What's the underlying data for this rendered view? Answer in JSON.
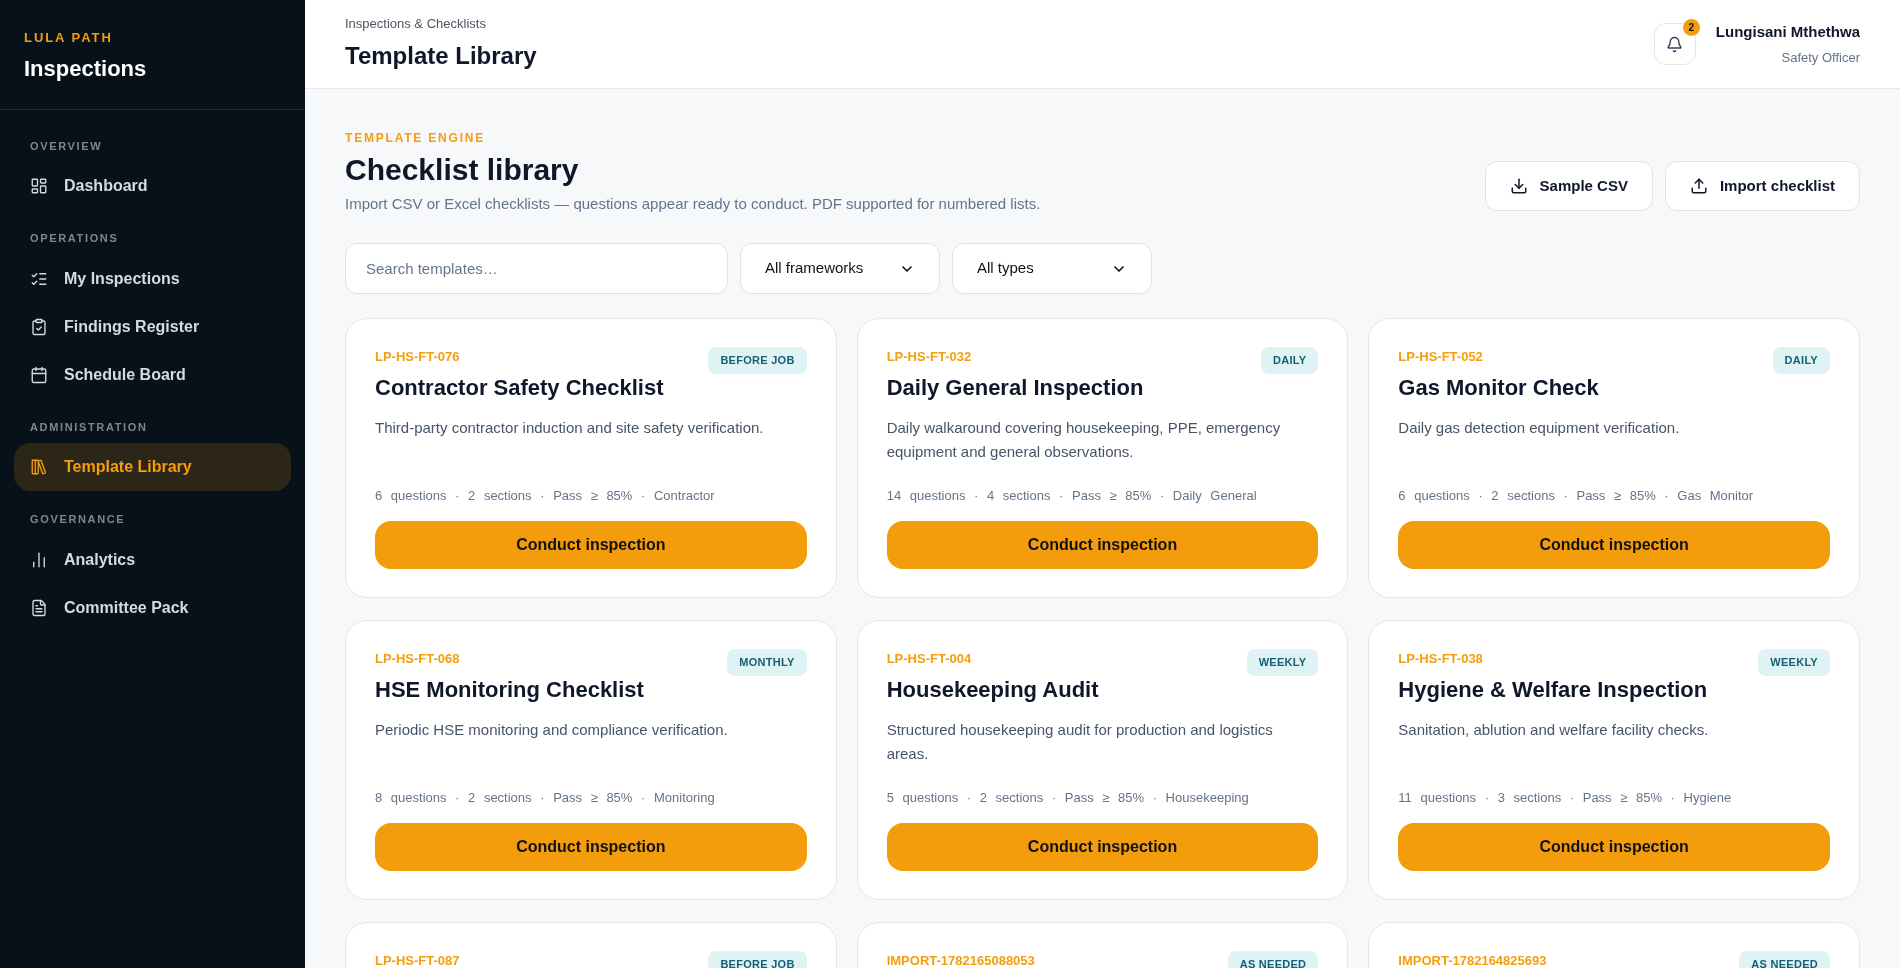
{
  "sidebar": {
    "brand": "LULA PATH",
    "title": "Inspections",
    "sections": [
      {
        "label": "OVERVIEW",
        "items": [
          {
            "label": "Dashboard",
            "selected": false
          }
        ]
      },
      {
        "label": "OPERATIONS",
        "items": [
          {
            "label": "My Inspections",
            "selected": false
          },
          {
            "label": "Findings Register",
            "selected": false
          },
          {
            "label": "Schedule Board",
            "selected": false
          }
        ]
      },
      {
        "label": "ADMINISTRATION",
        "items": [
          {
            "label": "Template Library",
            "selected": true
          }
        ]
      },
      {
        "label": "GOVERNANCE",
        "items": [
          {
            "label": "Analytics",
            "selected": false
          },
          {
            "label": "Committee Pack",
            "selected": false
          }
        ]
      }
    ]
  },
  "header": {
    "breadcrumb": "Inspections & Checklists",
    "title": "Template Library",
    "notifications": "2",
    "user": {
      "name": "Lungisani Mthethwa",
      "role": "Safety Officer"
    }
  },
  "page": {
    "eyebrow": "TEMPLATE ENGINE",
    "title": "Checklist library",
    "subtitle": "Import CSV or Excel checklists — questions appear ready to conduct. PDF supported for numbered lists.",
    "buttons": [
      "Sample CSV",
      "Import checklist"
    ]
  },
  "filters": {
    "search": {
      "placeholder": "Search templates…"
    },
    "framework": "All frameworks",
    "type": "All types"
  },
  "cards": [
    {
      "code": "LP-HS-FT-076",
      "badge": "BEFORE JOB",
      "title": "Contractor Safety Checklist",
      "description": "Third-party contractor induction and site safety verification.",
      "meta": "6 questions · 2 sections · Pass ≥ 85% · Contractor",
      "button": "Conduct inspection"
    },
    {
      "code": "LP-HS-FT-032",
      "badge": "DAILY",
      "title": "Daily General Inspection",
      "description": "Daily walkaround covering housekeeping, PPE, emergency equipment and general observations.",
      "meta": "14 questions · 4 sections · Pass ≥ 85% · Daily General",
      "button": "Conduct inspection"
    },
    {
      "code": "LP-HS-FT-052",
      "badge": "DAILY",
      "title": "Gas Monitor Check",
      "description": "Daily gas detection equipment verification.",
      "meta": "6 questions · 2 sections · Pass ≥ 85% · Gas Monitor",
      "button": "Conduct inspection"
    },
    {
      "code": "LP-HS-FT-068",
      "badge": "MONTHLY",
      "title": "HSE Monitoring Checklist",
      "description": "Periodic HSE monitoring and compliance verification.",
      "meta": "8 questions · 2 sections · Pass ≥ 85% · Monitoring",
      "button": "Conduct inspection"
    },
    {
      "code": "LP-HS-FT-004",
      "badge": "WEEKLY",
      "title": "Housekeeping Audit",
      "description": "Structured housekeeping audit for production and logistics areas.",
      "meta": "5 questions · 2 sections · Pass ≥ 85% · Housekeeping",
      "button": "Conduct inspection"
    },
    {
      "code": "LP-HS-FT-038",
      "badge": "WEEKLY",
      "title": "Hygiene & Welfare Inspection",
      "description": "Sanitation, ablution and welfare facility checks.",
      "meta": "11 questions · 3 sections · Pass ≥ 85% · Hygiene",
      "button": "Conduct inspection"
    },
    {
      "code": "LP-HS-FT-087",
      "badge": "BEFORE JOB"
    },
    {
      "code": "IMPORT-1782165088053",
      "badge": "AS NEEDED"
    },
    {
      "code": "IMPORT-1782164825693",
      "badge": "AS NEEDED"
    }
  ]
}
